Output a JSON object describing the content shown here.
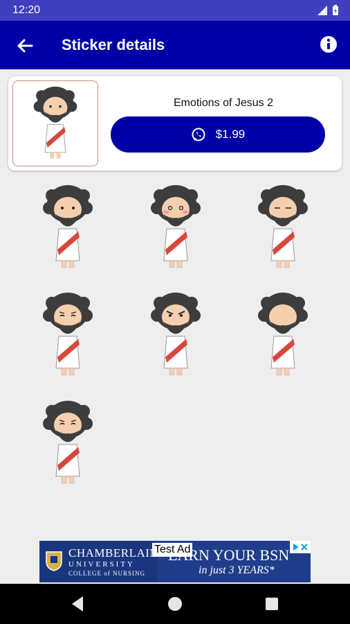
{
  "status_bar": {
    "time": "12:20"
  },
  "app_bar": {
    "title": "Sticker details"
  },
  "pack": {
    "title": "Emotions of Jesus 2",
    "price": "$1.99"
  },
  "stickers": [
    {
      "expression": "neutral"
    },
    {
      "expression": "blushing"
    },
    {
      "expression": "sleepy"
    },
    {
      "expression": "worried"
    },
    {
      "expression": "angry"
    },
    {
      "expression": "no-eyes"
    },
    {
      "expression": "sad"
    }
  ],
  "ad": {
    "label": "Test Ad",
    "brand_line1": "CHAMBERLAIN",
    "brand_line2": "UNIVERSITY",
    "brand_line3": "COLLEGE of NURSING",
    "headline": "EARN YOUR BSN",
    "subline": "in just 3 YEARS*"
  },
  "colors": {
    "primary": "#0000a6",
    "status_bar": "#3f3fbf",
    "background": "#eeeeee"
  }
}
